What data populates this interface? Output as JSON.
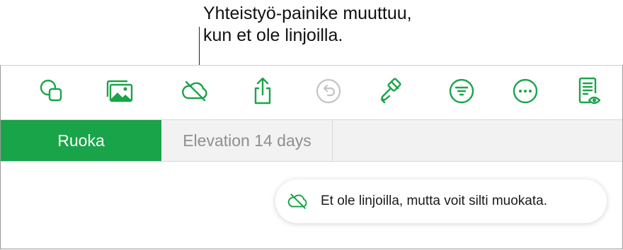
{
  "callout": {
    "text": "Yhteistyö-painike muuttuu,\nkun et ole linjoilla."
  },
  "toolbar": {
    "buttons": [
      {
        "name": "shapes-button",
        "icon": "shapes-icon"
      },
      {
        "name": "media-button",
        "icon": "photos-icon"
      },
      {
        "name": "collaborate-offline-button",
        "icon": "cloud-slash-icon"
      },
      {
        "name": "share-button",
        "icon": "share-icon"
      },
      {
        "name": "undo-button",
        "icon": "undo-icon",
        "disabled": true
      },
      {
        "name": "format-button",
        "icon": "paintbrush-icon"
      },
      {
        "name": "organize-button",
        "icon": "filter-icon"
      },
      {
        "name": "more-button",
        "icon": "ellipsis-icon"
      },
      {
        "name": "reading-view-button",
        "icon": "document-eye-icon"
      }
    ]
  },
  "tabs": [
    {
      "label": "Ruoka",
      "active": true
    },
    {
      "label": "Elevation 14 days",
      "active": false
    }
  ],
  "toast": {
    "text": "Et ole linjoilla, mutta voit silti muokata.",
    "icon": "cloud-slash-icon"
  },
  "colors": {
    "accent": "#1aa449",
    "disabled": "#c4c4c4"
  }
}
